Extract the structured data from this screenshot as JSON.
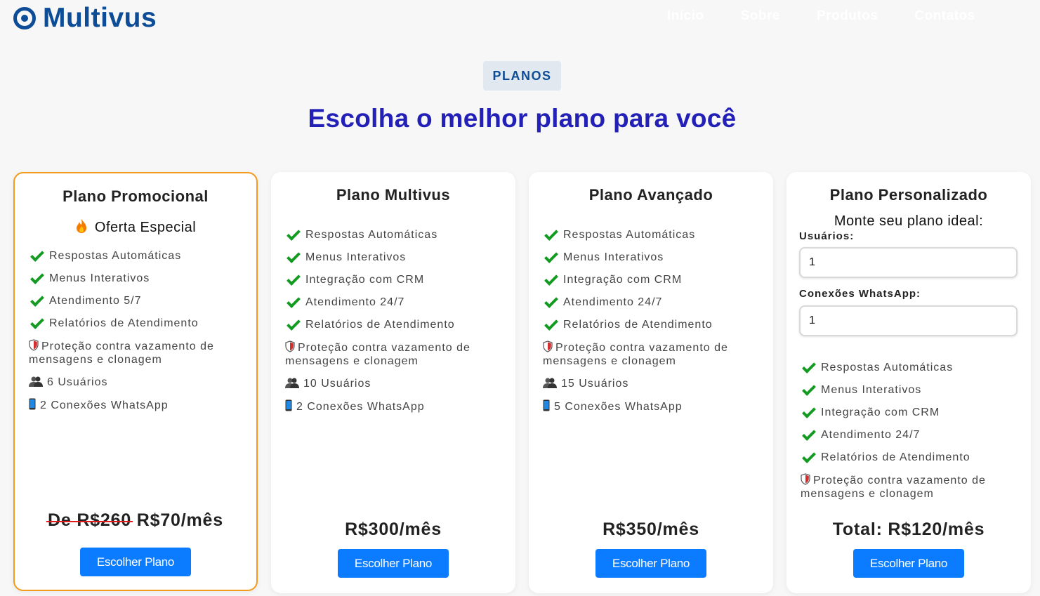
{
  "brand": {
    "name": "Multivus"
  },
  "nav": [
    "Início",
    "Sobre",
    "Produtos",
    "Contatos"
  ],
  "section": {
    "badge": "PLANOS",
    "headline": "Escolha o melhor plano para você"
  },
  "plans": [
    {
      "title": "Plano Promocional",
      "subtitle": "Oferta Especial",
      "features": [
        "Respostas Automáticas",
        "Menus Interativos",
        "Atendimento 5/7",
        "Relatórios de Atendimento"
      ],
      "protection": "Proteção contra vazamento de mensagens e clonagem",
      "users": "6 Usuários",
      "connections": "2 Conexões WhatsApp",
      "old_price": "De R$260",
      "price": "R$70/mês",
      "button": "Escolher Plano"
    },
    {
      "title": "Plano Multivus",
      "features": [
        "Respostas Automáticas",
        "Menus Interativos",
        "Integração com CRM",
        "Atendimento 24/7",
        "Relatórios de Atendimento"
      ],
      "protection": "Proteção contra vazamento de mensagens e clonagem",
      "users": "10 Usuários",
      "connections": "2 Conexões WhatsApp",
      "price": "R$300/mês",
      "button": "Escolher Plano"
    },
    {
      "title": "Plano Avançado",
      "features": [
        "Respostas Automáticas",
        "Menus Interativos",
        "Integração com CRM",
        "Atendimento 24/7",
        "Relatórios de Atendimento"
      ],
      "protection": "Proteção contra vazamento de mensagens e clonagem",
      "users": "15 Usuários",
      "connections": "5 Conexões WhatsApp",
      "price": "R$350/mês",
      "button": "Escolher Plano"
    },
    {
      "title": "Plano Personalizado",
      "subtitle": "Monte seu plano ideal:",
      "users_label": "Usuários:",
      "users_value": "1",
      "connections_label": "Conexões WhatsApp:",
      "connections_value": "1",
      "features": [
        "Respostas Automáticas",
        "Menus Interativos",
        "Integração com CRM",
        "Atendimento 24/7",
        "Relatórios de Atendimento"
      ],
      "protection": "Proteção contra vazamento de mensagens e clonagem",
      "price": "Total: R$120/mês",
      "button": "Escolher Plano"
    }
  ],
  "colors": {
    "brand": "#0d4c96",
    "headline": "#2320b8",
    "promo_border": "#f29b1d",
    "button": "#0b7bff",
    "check": "#139a21",
    "strike": "#e01b1b"
  }
}
